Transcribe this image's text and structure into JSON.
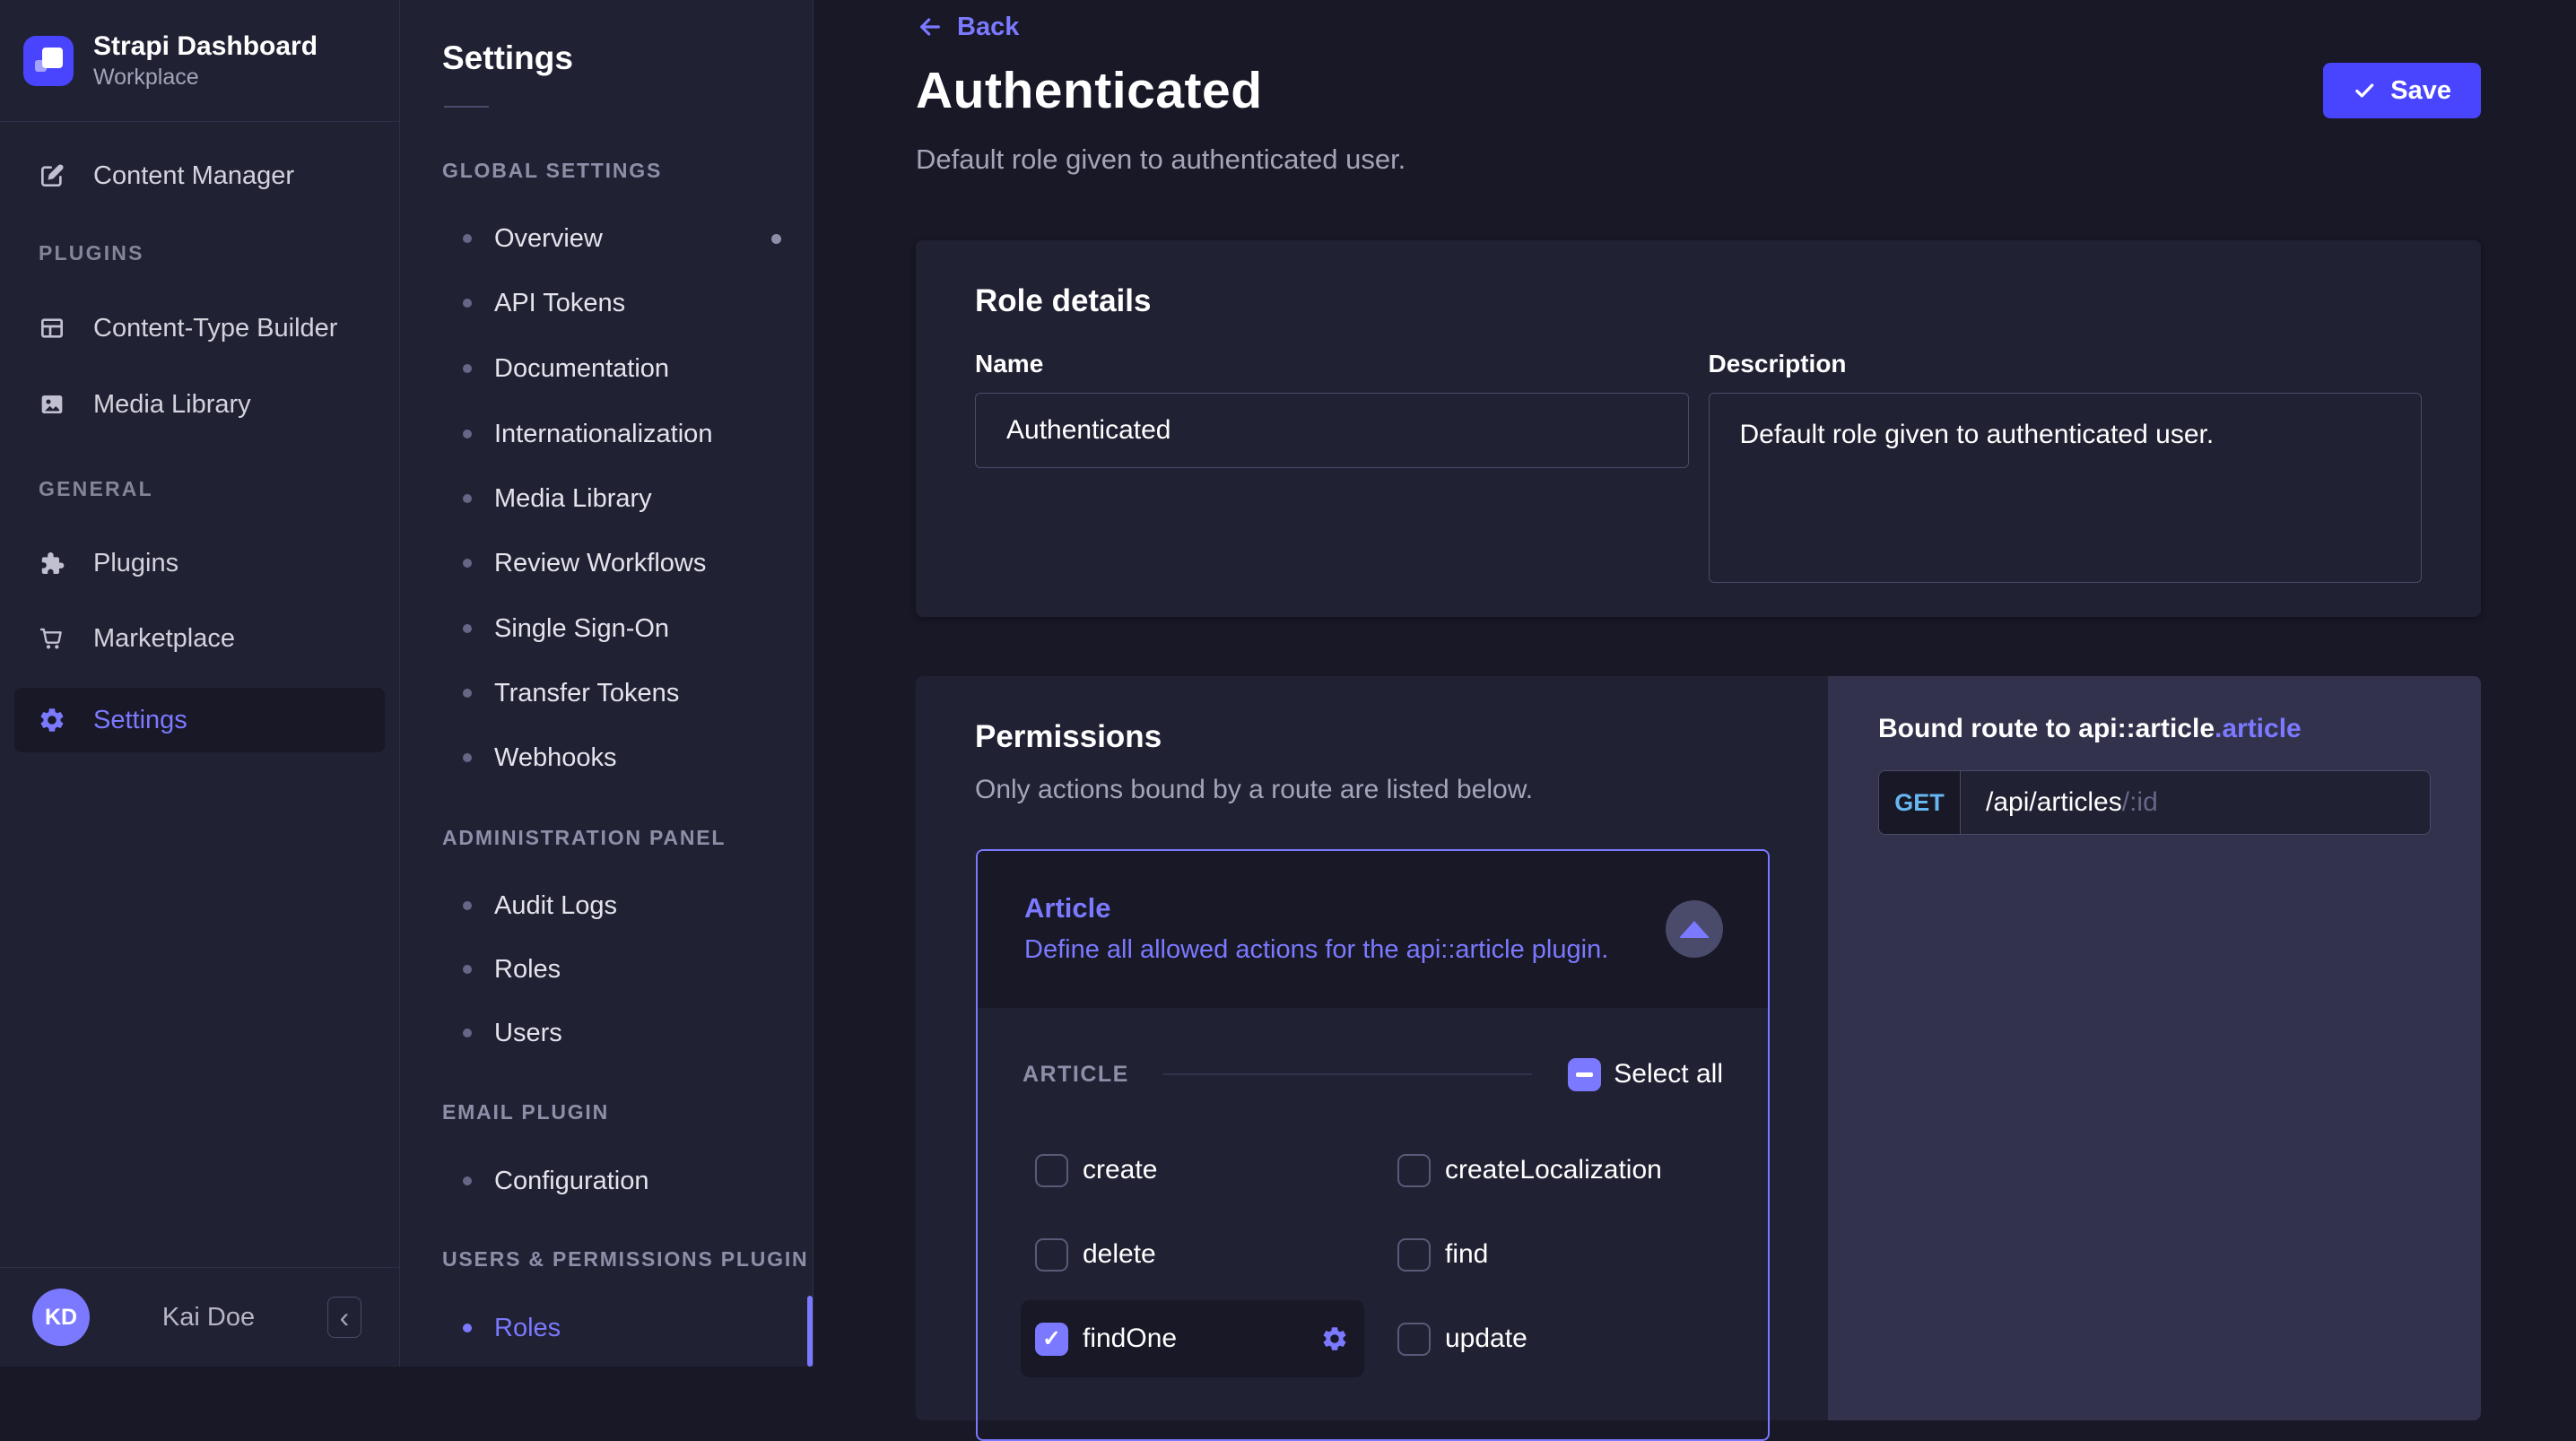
{
  "colors": {
    "primary": "#4945ff",
    "primary_light": "#7b79ff",
    "method_get_blue": "#66b7f1",
    "page_bg": "#181826",
    "panel_bg": "#212134"
  },
  "brand": {
    "title": "Strapi Dashboard",
    "subtitle": "Workplace"
  },
  "main_nav": {
    "top_item": {
      "label": "Content Manager",
      "icon": "pen-icon"
    },
    "sections": [
      {
        "label": "PLUGINS",
        "items": [
          {
            "label": "Content-Type Builder",
            "icon": "layout-icon"
          },
          {
            "label": "Media Library",
            "icon": "image-icon"
          }
        ]
      },
      {
        "label": "GENERAL",
        "items": [
          {
            "label": "Plugins",
            "icon": "puzzle-icon"
          },
          {
            "label": "Marketplace",
            "icon": "cart-icon"
          },
          {
            "label": "Settings",
            "icon": "gear-icon",
            "active": true
          }
        ]
      }
    ],
    "user": {
      "initials": "KD",
      "name": "Kai Doe"
    }
  },
  "settings_nav": {
    "title": "Settings",
    "overview_notification_dot": true,
    "groups": [
      {
        "label": "GLOBAL SETTINGS",
        "items": [
          "Overview",
          "API Tokens",
          "Documentation",
          "Internationalization",
          "Media Library",
          "Review Workflows",
          "Single Sign-On",
          "Transfer Tokens",
          "Webhooks"
        ]
      },
      {
        "label": "ADMINISTRATION PANEL",
        "items": [
          "Audit Logs",
          "Roles",
          "Users"
        ]
      },
      {
        "label": "EMAIL PLUGIN",
        "items": [
          "Configuration"
        ]
      },
      {
        "label": "USERS & PERMISSIONS PLUGIN",
        "items": [
          "Roles"
        ],
        "active_item": "Roles"
      }
    ]
  },
  "header": {
    "back_label": "Back",
    "title": "Authenticated",
    "subtitle": "Default role given to authenticated user.",
    "save_label": "Save"
  },
  "role_details": {
    "title": "Role details",
    "name_label": "Name",
    "name_value": "Authenticated",
    "description_label": "Description",
    "description_value": "Default role given to authenticated user."
  },
  "permissions": {
    "title": "Permissions",
    "subtitle": "Only actions bound by a route are listed below.",
    "accordion": {
      "title": "Article",
      "subtitle": "Define all allowed actions for the api::article plugin.",
      "expanded": true,
      "group_label": "ARTICLE",
      "select_all_label": "Select all",
      "select_all_state": "indeterminate",
      "actions": [
        {
          "label": "create",
          "checked": false
        },
        {
          "label": "createLocalization",
          "checked": false
        },
        {
          "label": "delete",
          "checked": false
        },
        {
          "label": "find",
          "checked": false
        },
        {
          "label": "findOne",
          "checked": true,
          "selected": true,
          "has_settings_gear": true
        },
        {
          "label": "update",
          "checked": false
        }
      ]
    }
  },
  "bound_route": {
    "title_text": "Bound route to api::article",
    "title_highlight": ".article",
    "method": "GET",
    "path": "/api/articles",
    "path_param": "/:id"
  }
}
